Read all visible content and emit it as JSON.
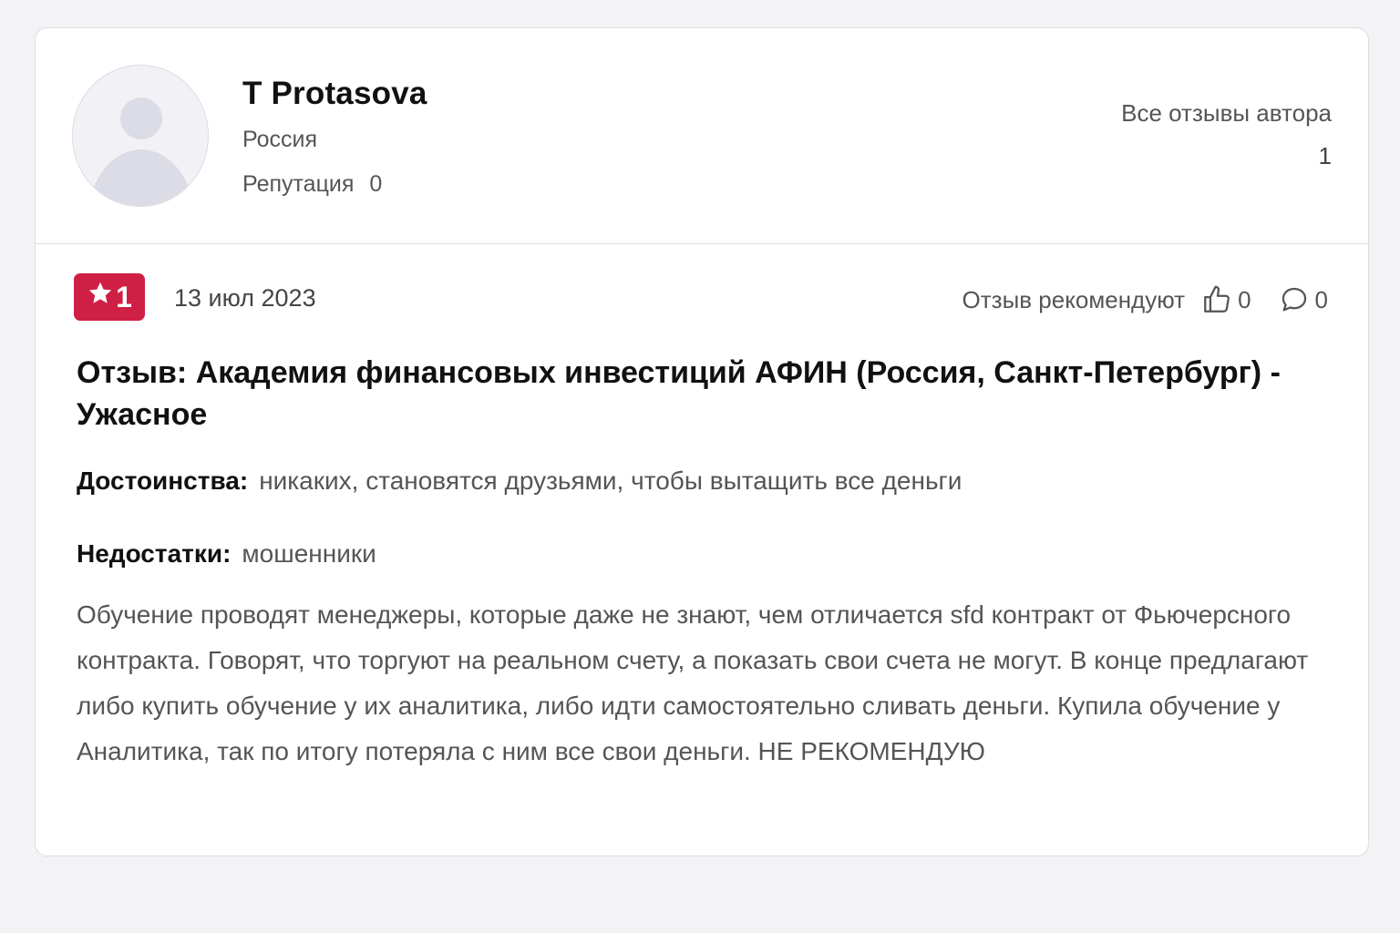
{
  "author": {
    "name": "T Protasova",
    "country": "Россия",
    "reputation_label": "Репутация",
    "reputation_value": "0",
    "all_reviews_label": "Все отзывы автора",
    "all_reviews_count": "1"
  },
  "review": {
    "rating": "1",
    "date": "13 июл 2023",
    "recommend_label": "Отзыв рекомендуют",
    "likes": "0",
    "comments": "0",
    "title": "Отзыв: Академия финансовых инвестиций АФИН (Россия, Санкт-Петербург) - Ужасное",
    "pros_label": "Достоинства:",
    "pros_text": "никаких, становятся друзьями, чтобы вытащить все деньги",
    "cons_label": "Недостатки:",
    "cons_text": "мошенники",
    "body": "Обучение проводят менеджеры, которые даже не знают, чем отличается sfd контракт от Фьючерсного контракта. Говорят, что торгуют на реальном счету, а показать свои счета не могут. В конце предлагают либо купить обучение у их аналитика, либо идти самостоятельно сливать деньги. Купила обучение у Аналитика, так по итогу потеряла с ним все свои деньги. НЕ РЕКОМЕНДУЮ"
  },
  "colors": {
    "rating_badge": "#cf1f45",
    "page_background": "#f3f3f6"
  },
  "icons": {
    "avatar": "default-user-avatar-icon",
    "rating": "star-icon",
    "like": "thumbs-up-icon",
    "comment": "speech-bubble-icon"
  }
}
